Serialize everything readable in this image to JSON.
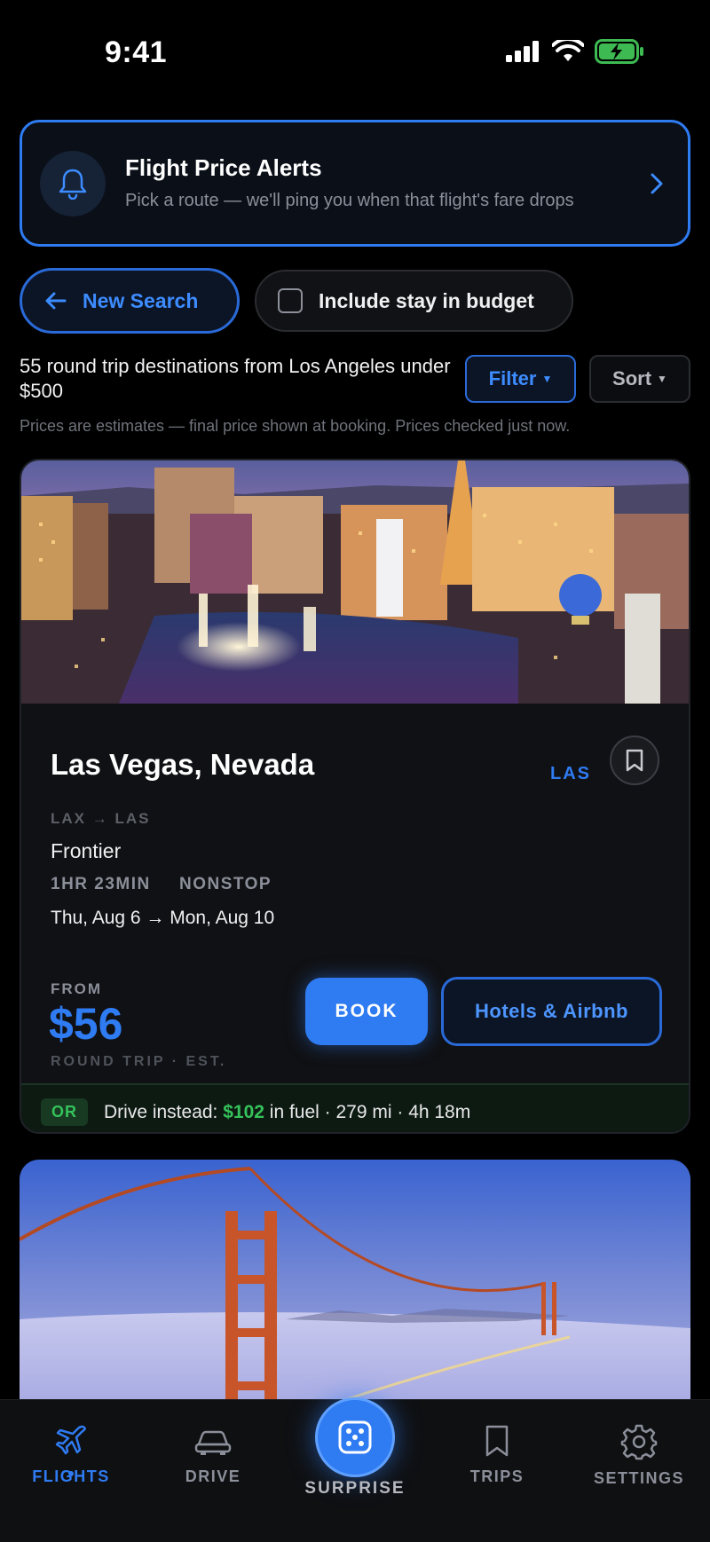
{
  "status": {
    "time": "9:41"
  },
  "alert": {
    "title": "Flight Price Alerts",
    "subtitle": "Pick a route — we'll ping you when that flight's fare drops"
  },
  "actions": {
    "new_search": "New Search",
    "include_stay": "Include stay in budget"
  },
  "results": {
    "count_text": "55 round trip destinations from Los Angeles under $500",
    "filter": "Filter",
    "sort": "Sort",
    "disclaimer": "Prices are estimates — final price shown at booking. Prices checked just now."
  },
  "card": {
    "destination": "Las Vegas, Nevada",
    "code": "LAS",
    "route": "LAX → LAS",
    "airline": "Frontier",
    "duration": "1HR 23MIN",
    "stops": "NONSTOP",
    "dates": "Thu, Aug 6 → Mon, Aug 10",
    "from_label": "FROM",
    "price": "$56",
    "price_note": "ROUND TRIP · EST.",
    "book": "BOOK",
    "hotels": "Hotels & Airbnb",
    "drive": {
      "badge": "OR",
      "prefix": "Drive instead:",
      "fuel_cost": "$102",
      "suffix": "in fuel · 279 mi · 4h 18m"
    }
  },
  "tabs": {
    "flights": "FLIGHTS",
    "drive": "DRIVE",
    "surprise": "SURPRISE",
    "trips": "TRIPS",
    "settings": "SETTINGS"
  },
  "colors": {
    "accent": "#2f7bf2",
    "green": "#35c25a",
    "background": "#000000"
  }
}
